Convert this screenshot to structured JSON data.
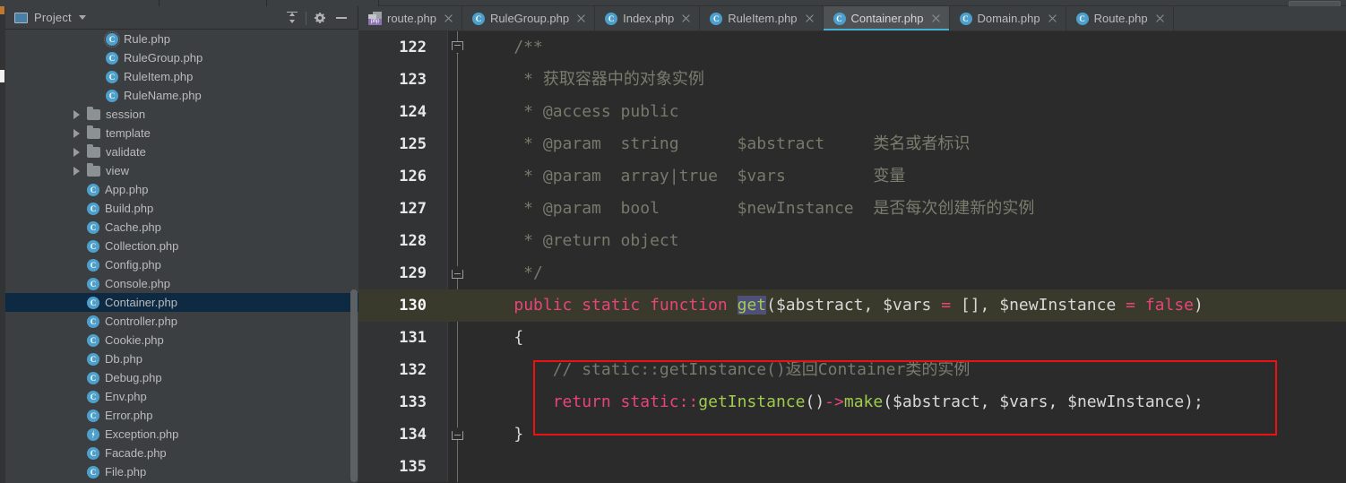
{
  "window": {
    "background_color": "#3c3f41",
    "editor_background_color": "#2b2b2b"
  },
  "project_panel": {
    "title": "Project",
    "icons": {
      "panel_icon": "project-window-icon",
      "dropdown": "chevron-down-icon",
      "collapse_all": "collapse-all-icon",
      "settings": "gear-icon",
      "hide": "minimize-icon"
    },
    "tree_items": [
      {
        "label": "Rule.php",
        "type": "class",
        "indent": 5,
        "selected": false,
        "focused": true
      },
      {
        "label": "RuleGroup.php",
        "type": "class",
        "indent": 5,
        "selected": false,
        "focused": false
      },
      {
        "label": "RuleItem.php",
        "type": "class",
        "indent": 5,
        "selected": false,
        "focused": false
      },
      {
        "label": "RuleName.php",
        "type": "class",
        "indent": 5,
        "selected": false,
        "focused": false
      },
      {
        "label": "session",
        "type": "folder",
        "indent": 4,
        "selected": false,
        "focused": false
      },
      {
        "label": "template",
        "type": "folder",
        "indent": 4,
        "selected": false,
        "focused": false
      },
      {
        "label": "validate",
        "type": "folder",
        "indent": 4,
        "selected": false,
        "focused": false
      },
      {
        "label": "view",
        "type": "folder",
        "indent": 4,
        "selected": false,
        "focused": false
      },
      {
        "label": "App.php",
        "type": "class",
        "indent": 4,
        "selected": false,
        "focused": false
      },
      {
        "label": "Build.php",
        "type": "class",
        "indent": 4,
        "selected": false,
        "focused": false
      },
      {
        "label": "Cache.php",
        "type": "class",
        "indent": 4,
        "selected": false,
        "focused": false
      },
      {
        "label": "Collection.php",
        "type": "class",
        "indent": 4,
        "selected": false,
        "focused": false
      },
      {
        "label": "Config.php",
        "type": "class",
        "indent": 4,
        "selected": false,
        "focused": false
      },
      {
        "label": "Console.php",
        "type": "class",
        "indent": 4,
        "selected": false,
        "focused": false
      },
      {
        "label": "Container.php",
        "type": "class",
        "indent": 4,
        "selected": true,
        "focused": false
      },
      {
        "label": "Controller.php",
        "type": "class",
        "indent": 4,
        "selected": false,
        "focused": false
      },
      {
        "label": "Cookie.php",
        "type": "class",
        "indent": 4,
        "selected": false,
        "focused": false
      },
      {
        "label": "Db.php",
        "type": "class",
        "indent": 4,
        "selected": false,
        "focused": false
      },
      {
        "label": "Debug.php",
        "type": "class",
        "indent": 4,
        "selected": false,
        "focused": false
      },
      {
        "label": "Env.php",
        "type": "class",
        "indent": 4,
        "selected": false,
        "focused": false
      },
      {
        "label": "Error.php",
        "type": "class",
        "indent": 4,
        "selected": false,
        "focused": false
      },
      {
        "label": "Exception.php",
        "type": "exception",
        "indent": 4,
        "selected": false,
        "focused": false
      },
      {
        "label": "Facade.php",
        "type": "class",
        "indent": 4,
        "selected": false,
        "focused": false
      },
      {
        "label": "File.php",
        "type": "class",
        "indent": 4,
        "selected": false,
        "focused": false
      }
    ]
  },
  "editor": {
    "tabs": [
      {
        "label": "route.php",
        "icon": "php-file-icon",
        "active": false
      },
      {
        "label": "RuleGroup.php",
        "icon": "php-class-icon",
        "active": false
      },
      {
        "label": "Index.php",
        "icon": "php-class-icon",
        "active": false
      },
      {
        "label": "RuleItem.php",
        "icon": "php-class-icon",
        "active": false
      },
      {
        "label": "Container.php",
        "icon": "php-class-icon",
        "active": true
      },
      {
        "label": "Domain.php",
        "icon": "php-class-icon",
        "active": false
      },
      {
        "label": "Route.php",
        "icon": "php-class-icon",
        "active": false
      }
    ],
    "active_tab": "Container.php",
    "accent_color": "#44b0d6",
    "current_line": 130,
    "lines": [
      {
        "number": "122",
        "fold": "start",
        "tokens": [
          {
            "t": "    /**",
            "c": "cmt"
          }
        ]
      },
      {
        "number": "123",
        "fold": "none",
        "tokens": [
          {
            "t": "     * ",
            "c": "cmt"
          },
          {
            "t": "获取容器中的对象实例",
            "c": "cmt-zh"
          }
        ]
      },
      {
        "number": "124",
        "fold": "none",
        "tokens": [
          {
            "t": "     * @access public",
            "c": "cmt"
          }
        ]
      },
      {
        "number": "125",
        "fold": "none",
        "tokens": [
          {
            "t": "     * @param  string      $abstract     ",
            "c": "cmt"
          },
          {
            "t": "类名或者标识",
            "c": "cmt-zh"
          }
        ]
      },
      {
        "number": "126",
        "fold": "none",
        "tokens": [
          {
            "t": "     * @param  array|true  $vars         ",
            "c": "cmt"
          },
          {
            "t": "变量",
            "c": "cmt-zh"
          }
        ]
      },
      {
        "number": "127",
        "fold": "none",
        "tokens": [
          {
            "t": "     * @param  bool        $newInstance  ",
            "c": "cmt"
          },
          {
            "t": "是否每次创建新的实例",
            "c": "cmt-zh"
          }
        ]
      },
      {
        "number": "128",
        "fold": "none",
        "tokens": [
          {
            "t": "     * @return object",
            "c": "cmt"
          }
        ]
      },
      {
        "number": "129",
        "fold": "end",
        "tokens": [
          {
            "t": "     */",
            "c": "cmt"
          }
        ]
      },
      {
        "number": "130",
        "fold": "start",
        "tokens": [
          {
            "t": "    ",
            "c": "op"
          },
          {
            "t": "public static function ",
            "c": "kw"
          },
          {
            "t": "get",
            "c": "fn sel"
          },
          {
            "t": "($abstract, $vars ",
            "c": "id"
          },
          {
            "t": "=",
            "c": "kw"
          },
          {
            "t": " [], $newInstance ",
            "c": "id"
          },
          {
            "t": "=",
            "c": "kw"
          },
          {
            "t": " ",
            "c": "id"
          },
          {
            "t": "false",
            "c": "kw"
          },
          {
            "t": ")",
            "c": "id"
          }
        ]
      },
      {
        "number": "131",
        "fold": "none",
        "tokens": [
          {
            "t": "    {",
            "c": "id"
          }
        ]
      },
      {
        "number": "132",
        "fold": "none",
        "tokens": [
          {
            "t": "        // static::getInstance()",
            "c": "cmt"
          },
          {
            "t": "返回",
            "c": "cmt-zh"
          },
          {
            "t": "Container",
            "c": "cmt"
          },
          {
            "t": "类的实例",
            "c": "cmt-zh"
          }
        ]
      },
      {
        "number": "133",
        "fold": "none",
        "tokens": [
          {
            "t": "        ",
            "c": "op"
          },
          {
            "t": "return static::",
            "c": "kw"
          },
          {
            "t": "getInstance",
            "c": "fn"
          },
          {
            "t": "()",
            "c": "id"
          },
          {
            "t": "->",
            "c": "kw"
          },
          {
            "t": "make",
            "c": "fn"
          },
          {
            "t": "($abstract, $vars, $newInstance);",
            "c": "id"
          }
        ]
      },
      {
        "number": "134",
        "fold": "end",
        "tokens": [
          {
            "t": "    }",
            "c": "id"
          }
        ]
      },
      {
        "number": "135",
        "fold": "none",
        "tokens": [
          {
            "t": "",
            "c": "id"
          }
        ]
      }
    ],
    "annotation_box": {
      "color": "#ee1111",
      "covers_lines": "132-133"
    }
  }
}
